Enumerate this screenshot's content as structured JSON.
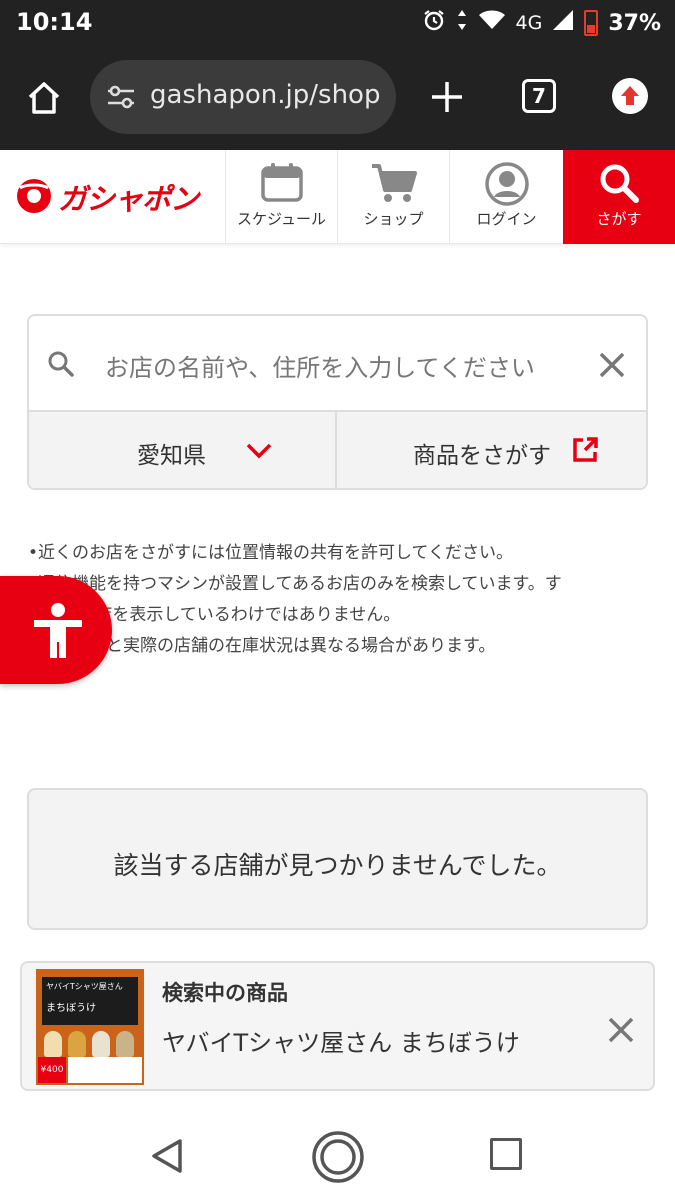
{
  "status_bar": {
    "time": "10:14",
    "network": "4G",
    "battery": "37%",
    "battery_level": 0.37
  },
  "browser": {
    "url": "gashapon.jp/shop",
    "tab_count": "7"
  },
  "header": {
    "logo_text": "ガシャポン",
    "nav": [
      {
        "label": "スケジュール",
        "icon": "calendar-icon"
      },
      {
        "label": "ショップ",
        "icon": "cart-icon"
      },
      {
        "label": "ログイン",
        "icon": "user-icon"
      },
      {
        "label": "さがす",
        "icon": "search-icon"
      }
    ]
  },
  "search": {
    "placeholder": "お店の名前や、住所を入力してください",
    "prefecture": "愛知県",
    "product_link": "商品をさがす"
  },
  "notes": [
    "•近くのお店をさがすには位置情報の共有を許可してください。",
    "•通信機能を持つマシンが設置してあるお店のみを検索しています。す",
    "べてのお店を表示しているわけではありません。",
    "•表示内容と実際の店舗の在庫状況は異なる場合があります。"
  ],
  "result": {
    "message": "該当する店舗が見つかりませんでした。"
  },
  "searching_item": {
    "label": "検索中の商品",
    "name": "ヤバイTシャツ屋さん まちぼうけ",
    "thumb_title": "ヤバイTシャツ屋さん",
    "thumb_subtitle": "まちぼうけ",
    "thumb_price": "¥400"
  },
  "colors": {
    "brand_red": "#e60012",
    "browser_dark": "#222222",
    "panel_gray": "#f3f3f3"
  }
}
